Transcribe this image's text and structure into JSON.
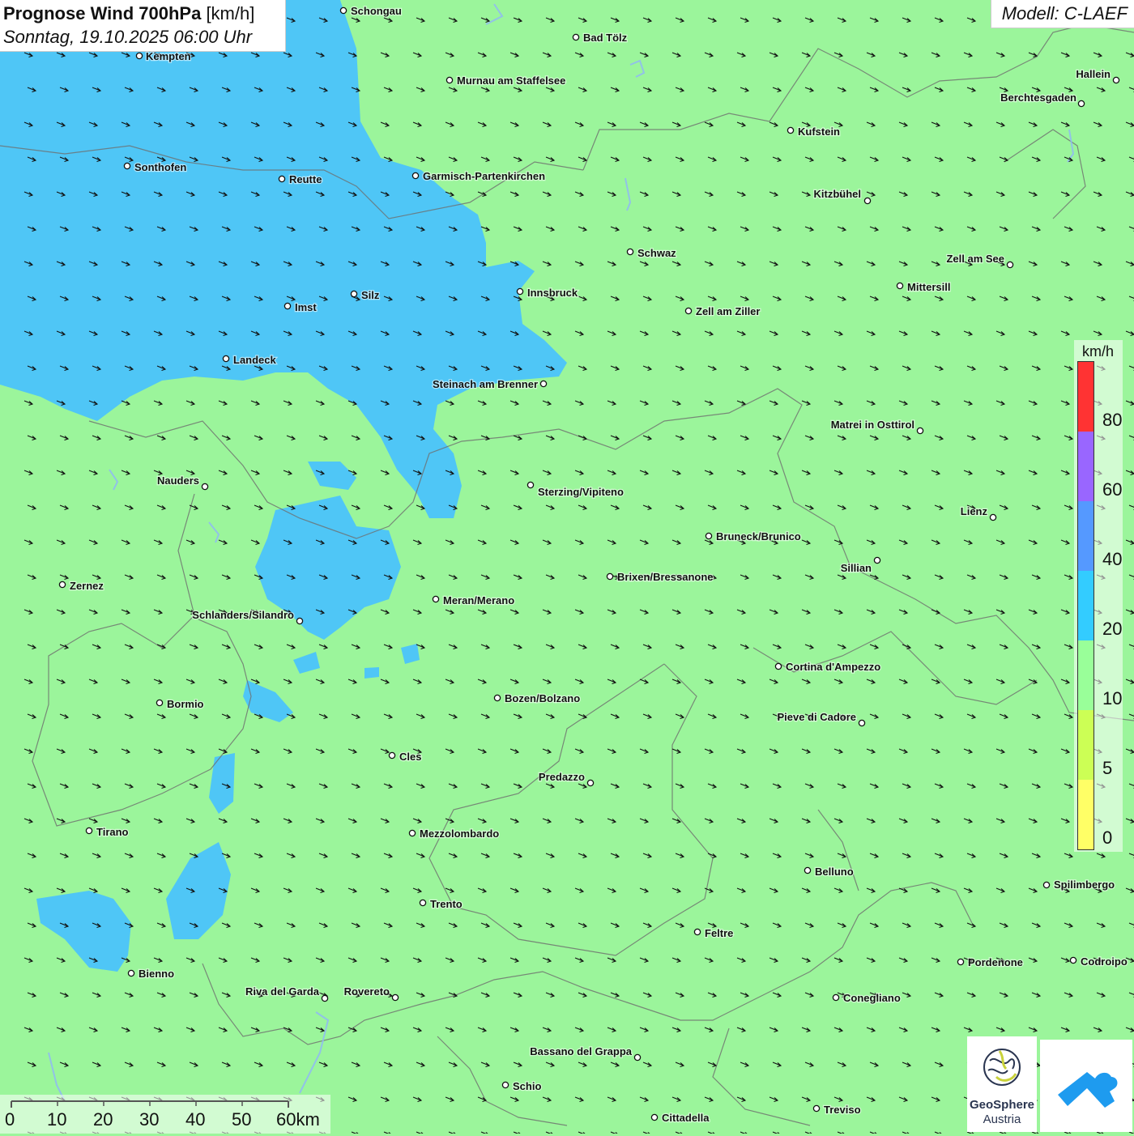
{
  "title": {
    "main": "Prognose Wind 700hPa",
    "unit": "[km/h]",
    "subtitle": "Sonntag, 19.10.2025 06:00 Uhr"
  },
  "model": "Modell: C-LAEF",
  "legend": {
    "unit": "km/h",
    "ticks": [
      "80",
      "60",
      "40",
      "20",
      "10",
      "5",
      "0"
    ],
    "colors": [
      "#ff3333",
      "#9966ff",
      "#5599ff",
      "#33ccff",
      "#99ff99",
      "#ccff55",
      "#ffff66"
    ]
  },
  "scale": {
    "labels": [
      "0",
      "10",
      "20",
      "30",
      "40",
      "50",
      "60km"
    ]
  },
  "colors": {
    "background": "#9bf59b",
    "wind_band": "#4fc6f6",
    "arrow": "#111111",
    "border": "#6e6e6e",
    "lake": "#8fb8f5"
  },
  "logos": {
    "geosphere_line1": "GeoSphere",
    "geosphere_line2": "Austria"
  },
  "cities": [
    {
      "name": "Schongau"
    },
    {
      "name": "Kempten"
    },
    {
      "name": "Bad Tölz"
    },
    {
      "name": "Murnau am Staffelsee"
    },
    {
      "name": "Hallein"
    },
    {
      "name": "Berchtesgaden"
    },
    {
      "name": "Kufstein"
    },
    {
      "name": "Sonthofen"
    },
    {
      "name": "Reutte"
    },
    {
      "name": "Garmisch-Partenkirchen"
    },
    {
      "name": "Kitzbühel"
    },
    {
      "name": "Schwaz"
    },
    {
      "name": "Zell am See"
    },
    {
      "name": "Mittersill"
    },
    {
      "name": "Silz"
    },
    {
      "name": "Innsbruck"
    },
    {
      "name": "Imst"
    },
    {
      "name": "Zell am Ziller"
    },
    {
      "name": "Landeck"
    },
    {
      "name": "Steinach am Brenner"
    },
    {
      "name": "Matrei in Osttirol"
    },
    {
      "name": "Nauders"
    },
    {
      "name": "Sterzing/Vipiteno"
    },
    {
      "name": "Lienz"
    },
    {
      "name": "Bruneck/Brunico"
    },
    {
      "name": "Sillian"
    },
    {
      "name": "Zernez"
    },
    {
      "name": "Brixen/Bressanone"
    },
    {
      "name": "Meran/Merano"
    },
    {
      "name": "Schlanders/Silandro"
    },
    {
      "name": "Cortina d'Ampezzo"
    },
    {
      "name": "Bozen/Bolzano"
    },
    {
      "name": "Bormio"
    },
    {
      "name": "Pieve di Cadore"
    },
    {
      "name": "Cles"
    },
    {
      "name": "Predazzo"
    },
    {
      "name": "Tirano"
    },
    {
      "name": "Mezzolombardo"
    },
    {
      "name": "Belluno"
    },
    {
      "name": "Spilimbergo"
    },
    {
      "name": "Trento"
    },
    {
      "name": "Feltre"
    },
    {
      "name": "Pordenone"
    },
    {
      "name": "Codroipo"
    },
    {
      "name": "Bienno"
    },
    {
      "name": "Riva del Garda"
    },
    {
      "name": "Rovereto"
    },
    {
      "name": "Conegliano"
    },
    {
      "name": "Bassano del Grappa"
    },
    {
      "name": "Schio"
    },
    {
      "name": "Treviso"
    },
    {
      "name": "Cittadella"
    }
  ]
}
